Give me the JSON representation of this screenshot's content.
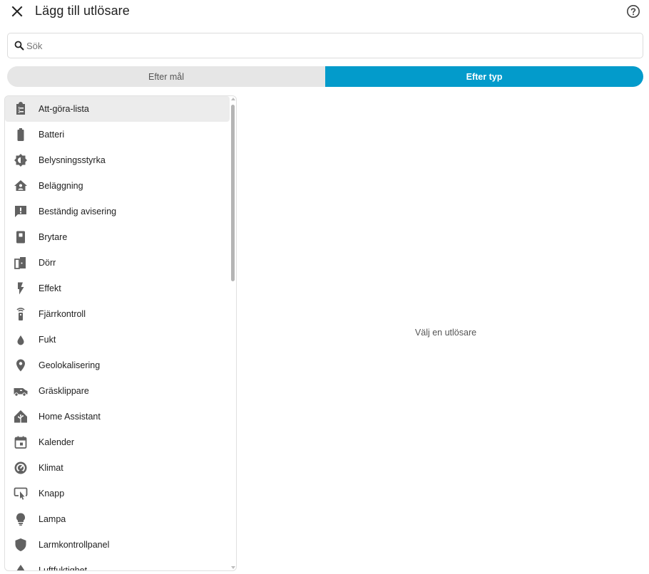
{
  "header": {
    "title": "Lägg till utlösare",
    "close_icon": "close-icon",
    "help_icon": "help-circle-icon"
  },
  "search": {
    "placeholder": "Sök",
    "value": ""
  },
  "tabs": [
    {
      "label": "Efter mål",
      "selected": false
    },
    {
      "label": "Efter typ",
      "selected": true
    }
  ],
  "colors": {
    "accent": "#039bcb",
    "icon": "#616161",
    "selected_row": "#ececec"
  },
  "list": {
    "items": [
      {
        "label": "Att-göra-lista",
        "icon": "clipboard-list-icon",
        "selected": true
      },
      {
        "label": "Batteri",
        "icon": "battery-icon"
      },
      {
        "label": "Belysningsstyrka",
        "icon": "brightness-icon"
      },
      {
        "label": "Beläggning",
        "icon": "home-account-icon"
      },
      {
        "label": "Beständig avisering",
        "icon": "message-alert-icon"
      },
      {
        "label": "Brytare",
        "icon": "switch-icon"
      },
      {
        "label": "Dörr",
        "icon": "door-icon"
      },
      {
        "label": "Effekt",
        "icon": "flash-icon"
      },
      {
        "label": "Fjärrkontroll",
        "icon": "remote-icon"
      },
      {
        "label": "Fukt",
        "icon": "water-drop-icon"
      },
      {
        "label": "Geolokalisering",
        "icon": "map-marker-icon"
      },
      {
        "label": "Gräsklippare",
        "icon": "robot-mower-icon"
      },
      {
        "label": "Home Assistant",
        "icon": "home-assistant-icon"
      },
      {
        "label": "Kalender",
        "icon": "calendar-icon"
      },
      {
        "label": "Klimat",
        "icon": "thermostat-icon"
      },
      {
        "label": "Knapp",
        "icon": "gesture-tap-button-icon"
      },
      {
        "label": "Lampa",
        "icon": "lightbulb-icon"
      },
      {
        "label": "Larmkontrollpanel",
        "icon": "shield-icon"
      },
      {
        "label": "Luftfuktighet",
        "icon": "water-percent-icon"
      }
    ]
  },
  "detail": {
    "empty_text": "Välj en utlösare"
  }
}
